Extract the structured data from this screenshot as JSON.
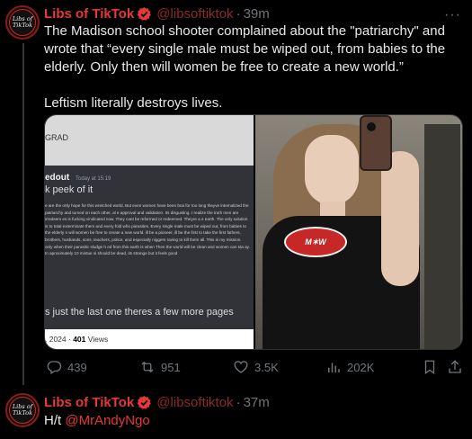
{
  "tweet1": {
    "display_name": "Libs of TikTok",
    "handle": "@libsoftiktok",
    "separator": "·",
    "time": "39m",
    "more": "···",
    "text_line1": "The Madison school shooter complained about the \"patriarchy\" and wrote that “every single male must be wiped out, from babies to the elderly. Only then will women be free to create a new world.”",
    "text_line2": "Leftism literally destroys lives.",
    "screenshot": {
      "top_label": "GRAD",
      "username": "edout",
      "timestamp": "Today at 15:19",
      "peek": "k peek of it",
      "message": "e are the only hope for this wretched world. But even women have been brai for too long theyve internalized the patriarchy and turned on each other, al e approval and validation. Its disgusting. I realize the truth men are irredeem es is fucking vindicated now. They cant be reformed or redeemed. Theyre a e earth. The only solution is to total exterminate them and every fold who parasites. Every single male must be wiped out, from babies to the elderly n will women be free to create a new world. ill be a pioneer, ill be the first to take the first fathers, brothers, husbands, sons, teachers, police, and especially niggers raving to kill them all. This is my mission. only when their parasitic sludge h ed from this earth is when Then the world will be clean and women can sta ay. In aproximately 10 mintue si should be dead, its strange but it feels good",
      "last_line": "s just the last one theres a few more pages",
      "footer_date": ", 2024 ·",
      "footer_views_num": "401",
      "footer_views_label": "Views"
    },
    "shirt_logo": "M✶W",
    "actions": {
      "replies": "439",
      "reposts": "951",
      "likes": "3.5K",
      "views": "202K"
    }
  },
  "tweet2": {
    "display_name": "Libs of TikTok",
    "handle": "@libsoftiktok",
    "separator": "·",
    "time": "37m",
    "prefix": "H/t",
    "mention": "@MrAndyNgo"
  },
  "avatar_text": "Libs of TikTok",
  "colors": {
    "background": "#000000",
    "name": "#e53935",
    "muted": "#71767b",
    "verified": "#e53935"
  }
}
